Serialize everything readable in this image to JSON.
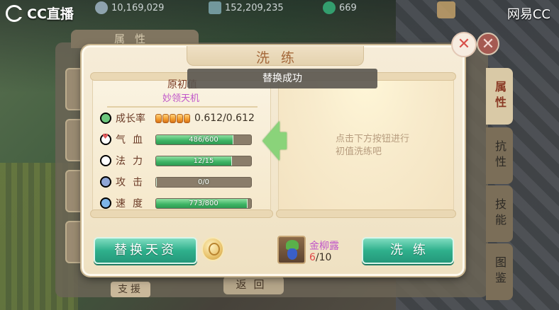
{
  "stream": {
    "platform_logo": "CC直播",
    "watermark": "网易CC"
  },
  "resources": {
    "silver": "10,169,029",
    "coins": "152,209,235",
    "jade": "669"
  },
  "background_window": {
    "title": "属性",
    "tabs": [
      "属性",
      "抗性",
      "技能",
      "图鉴"
    ],
    "support_button": "支援",
    "return_button": "返回",
    "close_icon": "✕"
  },
  "dialog": {
    "title": "洗练",
    "toast": "替换成功",
    "close_icon": "✕",
    "left_panel": {
      "heading": "原初值",
      "pet_name": "妙领天机",
      "growth": {
        "label": "成长率",
        "pips": 5,
        "value": "0.612/0.612"
      },
      "stats": [
        {
          "label": "气血",
          "text": "486/600",
          "fill": 0.81,
          "icon": "heart-icon"
        },
        {
          "label": "法力",
          "text": "12/15",
          "fill": 0.8,
          "icon": "mana-icon"
        },
        {
          "label": "攻击",
          "text": "0/0",
          "fill": 0,
          "icon": "sword-icon"
        },
        {
          "label": "速度",
          "text": "773/800",
          "fill": 0.966,
          "icon": "speed-icon"
        }
      ]
    },
    "right_panel": {
      "hint_line1": "点击下方按钮进行",
      "hint_line2": "初值洗练吧"
    },
    "replace_button": "替换天资",
    "refine_button": "洗练",
    "item": {
      "name": "金柳露",
      "have": "6",
      "need": "/10"
    }
  },
  "colors": {
    "button_green": "#2fb08c",
    "bar_green": "#3cb363",
    "pet_name_purple": "#c055c9",
    "close_red": "#d8504a"
  }
}
